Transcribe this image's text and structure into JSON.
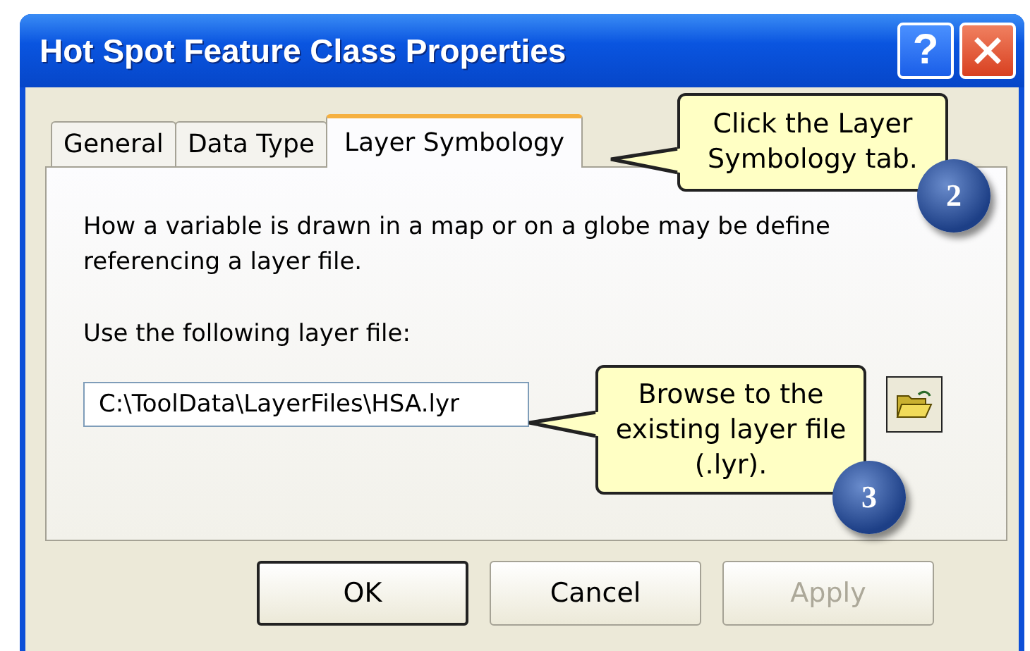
{
  "window": {
    "title": "Hot Spot Feature Class Properties",
    "title_buttons": [
      {
        "kind": "help",
        "label": "?"
      },
      {
        "kind": "close"
      }
    ]
  },
  "tabs": [
    {
      "label": "General",
      "selected": false
    },
    {
      "label": "Data Type",
      "selected": false
    },
    {
      "label": "Layer Symbology",
      "selected": true
    }
  ],
  "panel": {
    "description": [
      "How a variable is drawn in a map or on a globe may be define",
      "referencing a layer file."
    ],
    "field_label": "Use the following layer file:",
    "field_value": "C:\\ToolData\\LayerFiles\\HSA.lyr"
  },
  "buttons": [
    {
      "label": "OK",
      "disabled": false
    },
    {
      "label": "Cancel",
      "disabled": false
    },
    {
      "label": "Apply",
      "disabled": true
    }
  ],
  "callouts": [
    {
      "text": "Click the Layer Symbology tab.",
      "step": "2"
    },
    {
      "text": "Browse to the existing layer file (.lyr).",
      "step": "3"
    }
  ]
}
